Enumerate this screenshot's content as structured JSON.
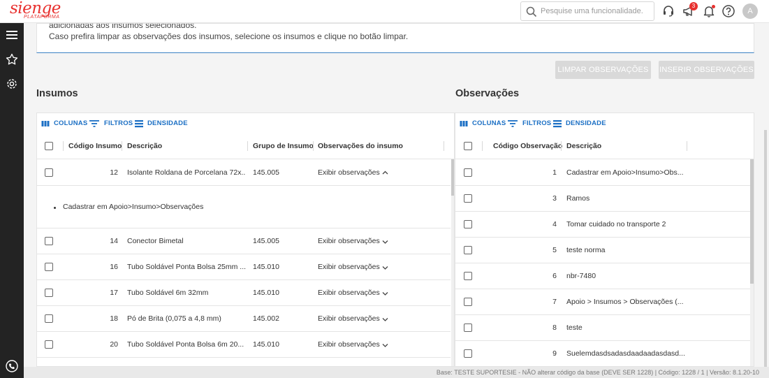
{
  "app": {
    "logo_main": "sienge",
    "logo_sub": "PLATAFORMA",
    "search_placeholder": "Pesquise uma funcionalidade.",
    "notification_count": "3",
    "avatar_letter": "A"
  },
  "info": {
    "line1": "adicionadas aos insumos selecionados.",
    "line2": "Caso prefira limpar as observações dos insumos, selecione os insumos e clique no botão limpar."
  },
  "actions": {
    "clear_label": "LIMPAR OBSERVAÇÕES",
    "insert_label": "INSERIR OBSERVAÇÕES"
  },
  "toolbar": {
    "columns": "COLUNAS",
    "filters": "FILTROS",
    "density": "DENSIDADE"
  },
  "insumos": {
    "title": "Insumos",
    "headers": {
      "code": "Código Insumo",
      "description": "Descrição",
      "group": "Grupo de Insumo",
      "obs": "Observações do insumo"
    },
    "expanded_note": "Cadastrar em Apoio>Insumo>Observações",
    "rows": [
      {
        "code": "12",
        "description": "Isolante Roldana de Porcelana 72x...",
        "group": "145.005",
        "obs": "Exibir observações"
      },
      {
        "code": "14",
        "description": "Conector Bimetal",
        "group": "145.005",
        "obs": "Exibir observações"
      },
      {
        "code": "16",
        "description": "Tubo Soldável Ponta Bolsa 25mm ...",
        "group": "145.010",
        "obs": "Exibir observações"
      },
      {
        "code": "17",
        "description": "Tubo Soldável 6m 32mm",
        "group": "145.010",
        "obs": "Exibir observações"
      },
      {
        "code": "18",
        "description": "Pó de Brita (0,075 a 4,8 mm)",
        "group": "145.002",
        "obs": "Exibir observações"
      },
      {
        "code": "20",
        "description": "Tubo Soldável Ponta Bolsa 6m 20...",
        "group": "145.010",
        "obs": "Exibir observações"
      }
    ]
  },
  "observacoes": {
    "title": "Observações",
    "headers": {
      "code": "Código Observação",
      "description": "Descrição"
    },
    "rows": [
      {
        "code": "1",
        "description": "Cadastrar em Apoio>Insumo>Obs..."
      },
      {
        "code": "3",
        "description": "Ramos"
      },
      {
        "code": "4",
        "description": "Tomar cuidado no transporte 2"
      },
      {
        "code": "5",
        "description": "teste norma"
      },
      {
        "code": "6",
        "description": "nbr-7480"
      },
      {
        "code": "7",
        "description": "Apoio > Insumos > Observações (..."
      },
      {
        "code": "8",
        "description": "teste"
      },
      {
        "code": "9",
        "description": "Suelemdasdsadasdaadaadasdasd..."
      }
    ]
  },
  "footer": {
    "text": "Base: TESTE SUPORTESIE - NÃO alterar código da base (DEVE SER 1228) | Código: 1228 / 1 | Versão: 8.1.20-10"
  }
}
